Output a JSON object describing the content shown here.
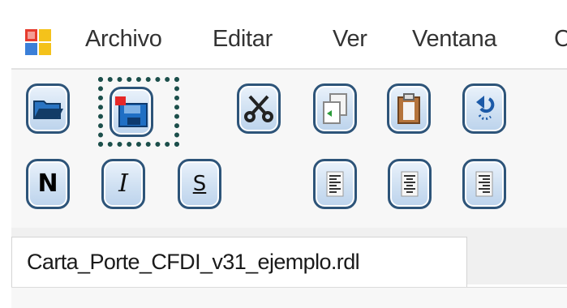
{
  "menu": {
    "items": [
      "Archivo",
      "Editar",
      "Ver",
      "Ventana",
      "C"
    ]
  },
  "toolbar": {
    "row1": [
      {
        "id": "open",
        "icon": "open-folder-icon"
      },
      {
        "id": "save",
        "icon": "save-disk-icon",
        "highlighted": true
      },
      {
        "id": "cut",
        "icon": "scissors-icon"
      },
      {
        "id": "copy",
        "icon": "copy-icon"
      },
      {
        "id": "paste",
        "icon": "clipboard-icon"
      },
      {
        "id": "undo",
        "icon": "undo-arrow-icon"
      }
    ],
    "row2": {
      "bold": "N",
      "italic": "I",
      "strike": "S",
      "align": [
        "align-left-icon",
        "align-center-icon",
        "align-right-icon"
      ]
    }
  },
  "document_tab": {
    "label": "Carta_Porte_CFDI_v31_ejemplo.rdl"
  },
  "colors": {
    "button_border": "#2d5479",
    "button_fill": "#cfe0f2",
    "highlight": "#1c4f4b"
  }
}
